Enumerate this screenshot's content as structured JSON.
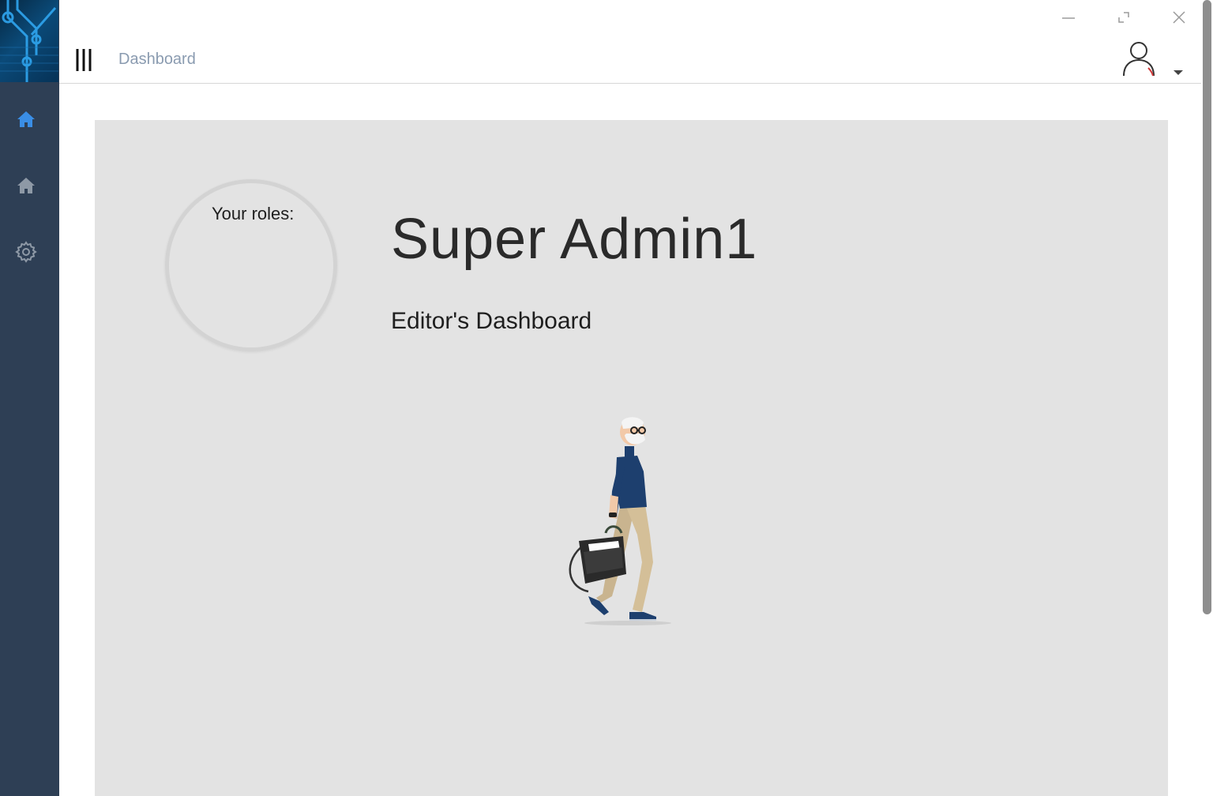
{
  "sidebar": {
    "items": [
      {
        "icon": "home-icon",
        "active": true,
        "color": "#3a8ee6"
      },
      {
        "icon": "home-icon",
        "active": false,
        "color": "#8e99a6"
      },
      {
        "icon": "gear-icon",
        "active": false,
        "color": "#8e99a6"
      }
    ]
  },
  "header": {
    "breadcrumb": "Dashboard"
  },
  "main": {
    "roles_label": "Your roles:",
    "user_name": "Super Admin1",
    "dashboard_title": "Editor's Dashboard"
  },
  "colors": {
    "sidebar_bg": "#2e3f55",
    "panel_bg": "#e3e3e3",
    "accent": "#3a8ee6"
  }
}
